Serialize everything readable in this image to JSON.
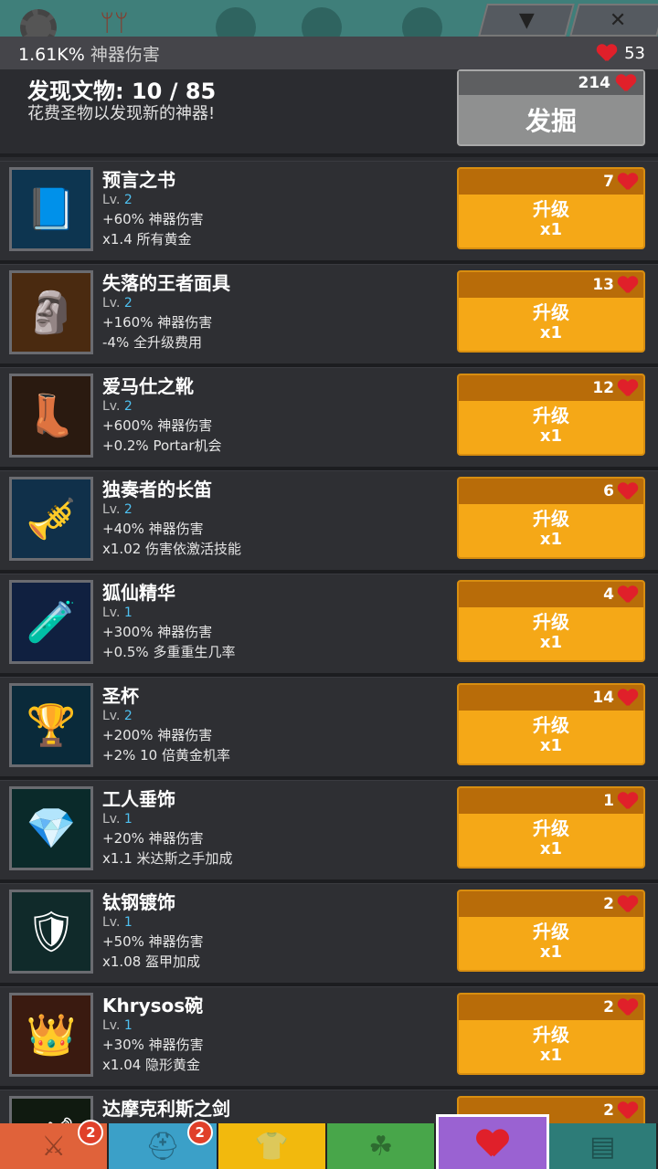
{
  "header": {
    "artifact_damage_value": "1.61K%",
    "artifact_damage_label": "神器伤害",
    "relics_count": "53"
  },
  "discover": {
    "title": "发现文物: 10 / 85",
    "subtitle": "花费圣物以发现新的神器!",
    "cost": "214",
    "button_label": "发掘"
  },
  "artifacts": [
    {
      "name": "预言之书",
      "lv_prefix": "Lv.",
      "level": "2",
      "effect1": "+60% 神器伤害",
      "effect2": "x1.4 所有黄金",
      "cost": "7",
      "icon": "book-icon"
    },
    {
      "name": "失落的王者面具",
      "lv_prefix": "Lv.",
      "level": "2",
      "effect1": "+160% 神器伤害",
      "effect2": "-4% 全升级费用",
      "cost": "13",
      "icon": "mask-icon"
    },
    {
      "name": "爱马仕之靴",
      "lv_prefix": "Lv.",
      "level": "2",
      "effect1": "+600% 神器伤害",
      "effect2": "+0.2% Portar机会",
      "cost": "12",
      "icon": "boots-icon"
    },
    {
      "name": "独奏者的长笛",
      "lv_prefix": "Lv.",
      "level": "2",
      "effect1": "+40% 神器伤害",
      "effect2": "x1.02 伤害依激活技能",
      "cost": "6",
      "icon": "flute-icon"
    },
    {
      "name": "狐仙精华",
      "lv_prefix": "Lv.",
      "level": "1",
      "effect1": "+300% 神器伤害",
      "effect2": "+0.5% 多重重生几率",
      "cost": "4",
      "icon": "potion-icon"
    },
    {
      "name": "圣杯",
      "lv_prefix": "Lv.",
      "level": "2",
      "effect1": "+200% 神器伤害",
      "effect2": "+2% 10 倍黄金机率",
      "cost": "14",
      "icon": "chalice-icon"
    },
    {
      "name": "工人垂饰",
      "lv_prefix": "Lv.",
      "level": "1",
      "effect1": "+20% 神器伤害",
      "effect2": "x1.1 米达斯之手加成",
      "cost": "1",
      "icon": "pendant-icon"
    },
    {
      "name": "钛钢镀饰",
      "lv_prefix": "Lv.",
      "level": "1",
      "effect1": "+50% 神器伤害",
      "effect2": "x1.08 盔甲加成",
      "cost": "2",
      "icon": "armor-icon"
    },
    {
      "name": "Khrysos碗",
      "lv_prefix": "Lv.",
      "level": "1",
      "effect1": "+30% 神器伤害",
      "effect2": "x1.04 隐形黄金",
      "cost": "2",
      "icon": "bowl-icon"
    },
    {
      "name": "达摩克利斯之剑",
      "lv_prefix": "",
      "level": "",
      "effect1": "",
      "effect2": "",
      "cost": "2",
      "icon": "sword-icon"
    }
  ],
  "upgrade_label": "升级",
  "upgrade_mult": "x1",
  "tabs": [
    {
      "icon": "sword-icon",
      "badge": "2"
    },
    {
      "icon": "helmet-icon",
      "badge": "2"
    },
    {
      "icon": "shirt-icon",
      "badge": ""
    },
    {
      "icon": "pet-icon",
      "badge": ""
    },
    {
      "icon": "heart-icon",
      "badge": ""
    },
    {
      "icon": "shop-icon",
      "badge": ""
    }
  ]
}
